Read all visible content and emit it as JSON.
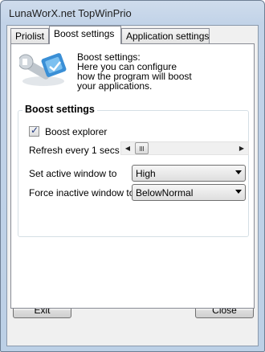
{
  "window": {
    "title": "LunaWorX.net TopWinPrio"
  },
  "tabs": [
    {
      "label": "Priolist"
    },
    {
      "label": "Boost settings"
    },
    {
      "label": "Application settings"
    }
  ],
  "intro": {
    "line1": "Boost settings:",
    "line2": "Here you can configure",
    "line3": "how the program will boost",
    "line4": "your applications."
  },
  "group": {
    "title": "Boost settings",
    "boost_explorer": {
      "label": "Boost explorer",
      "checked": true
    },
    "refresh": {
      "label": "Refresh every 1 secs"
    },
    "active_window": {
      "label": "Set active window to",
      "value": "High"
    },
    "inactive_window": {
      "label": "Force inactive window to",
      "value": "BelowNormal"
    }
  },
  "buttons": {
    "exit": "Exit",
    "close": "Close"
  },
  "icons": {
    "intro": "tools-icon",
    "checkbox": "checkmark-icon"
  }
}
